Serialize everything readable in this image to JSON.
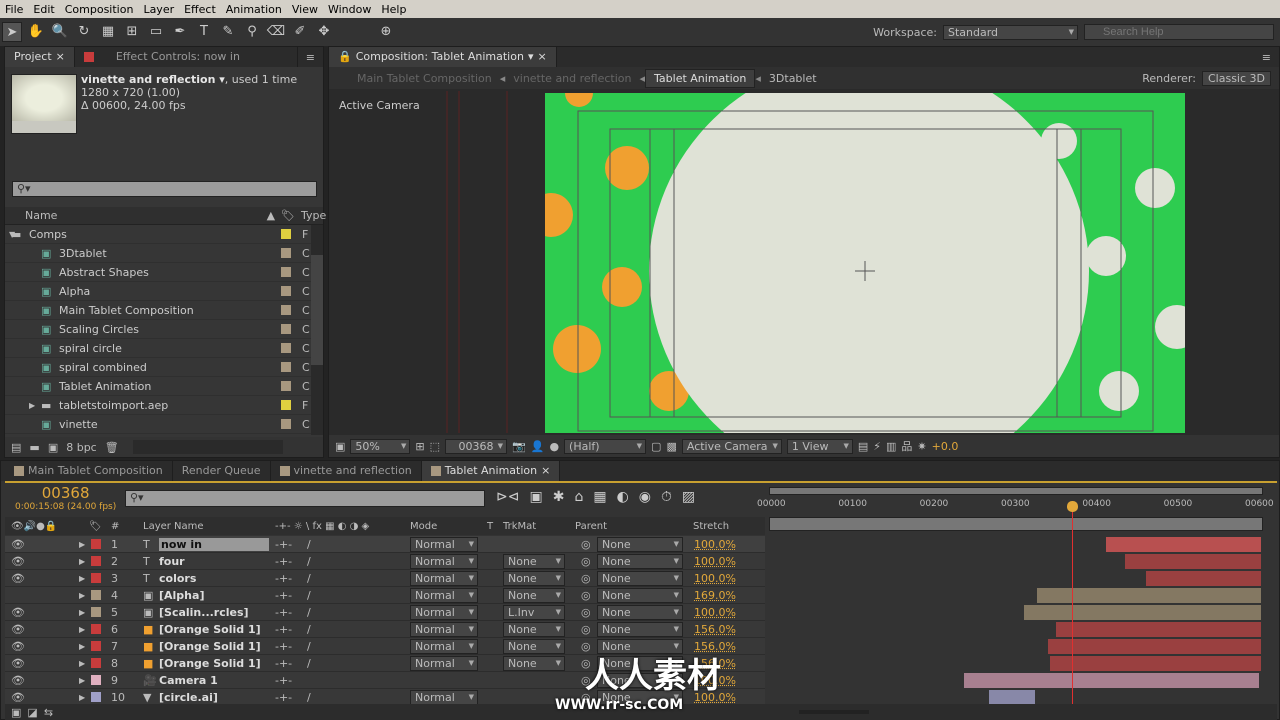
{
  "menu": [
    "File",
    "Edit",
    "Composition",
    "Layer",
    "Effect",
    "Animation",
    "View",
    "Window",
    "Help"
  ],
  "workspace": {
    "label": "Workspace:",
    "value": "Standard"
  },
  "search_help": {
    "placeholder": "Search Help"
  },
  "project": {
    "tabs": [
      "Project",
      "Effect Controls: now in"
    ],
    "selected_name": "vinette and reflection ▾",
    "used": ", used 1 time",
    "dims": "1280 x 720 (1.00)",
    "duration": "Δ 00600, 24.00 fps",
    "col_name": "Name",
    "col_type": "Type",
    "items": [
      {
        "name": "Comps",
        "kind": "folder",
        "label": "#e0d040",
        "type": "F",
        "indent": 0,
        "expanded": true
      },
      {
        "name": "3Dtablet",
        "kind": "comp",
        "label": "#a89880",
        "type": "C",
        "indent": 1
      },
      {
        "name": "Abstract Shapes",
        "kind": "comp",
        "label": "#a89880",
        "type": "C",
        "indent": 1
      },
      {
        "name": "Alpha",
        "kind": "comp",
        "label": "#a89880",
        "type": "C",
        "indent": 1
      },
      {
        "name": "Main Tablet Composition",
        "kind": "comp",
        "label": "#a89880",
        "type": "C",
        "indent": 1
      },
      {
        "name": "Scaling Circles",
        "kind": "comp",
        "label": "#a89880",
        "type": "C",
        "indent": 1
      },
      {
        "name": "spiral circle",
        "kind": "comp",
        "label": "#a89880",
        "type": "C",
        "indent": 1
      },
      {
        "name": "spiral combined",
        "kind": "comp",
        "label": "#a89880",
        "type": "C",
        "indent": 1
      },
      {
        "name": "Tablet Animation",
        "kind": "comp",
        "label": "#a89880",
        "type": "C",
        "indent": 1
      },
      {
        "name": "tabletstoimport.aep",
        "kind": "folder",
        "label": "#e0d040",
        "type": "F",
        "indent": 1,
        "expanded": false
      },
      {
        "name": "vinette",
        "kind": "comp",
        "label": "#a89880",
        "type": "C",
        "indent": 1
      }
    ],
    "bpc": "8 bpc"
  },
  "comp": {
    "tab": "Composition: Tablet Animation",
    "breadcrumbs": [
      "Main Tablet Composition",
      "vinette and reflection",
      "Tablet Animation",
      "3Dtablet"
    ],
    "active_breadcrumb": 2,
    "renderer_label": "Renderer:",
    "renderer": "Classic 3D",
    "view_label": "Active Camera",
    "zoom": "50%",
    "timecode": "00368",
    "resolution": "(Half)",
    "camera": "Active Camera",
    "views": "1 View",
    "exposure": "+0.0"
  },
  "timeline": {
    "tabs": [
      "Main Tablet Composition",
      "Render Queue",
      "vinette and reflection",
      "Tablet Animation"
    ],
    "active_tab": 3,
    "current_frame": "00368",
    "current_time": "0:00:15:08 (24.00 fps)",
    "headers": {
      "num": "#",
      "name": "Layer Name",
      "mode": "Mode",
      "t": "T",
      "trkmat": "TrkMat",
      "parent": "Parent",
      "stretch": "Stretch"
    },
    "ruler": [
      "00000",
      "00100",
      "00200",
      "00300",
      "00400",
      "00500",
      "00600"
    ],
    "duration_frames": 600,
    "cti_frame": 368,
    "layers": [
      {
        "n": "1",
        "name": "now in",
        "icon": "text",
        "label": "#c83c3c",
        "mode": "Normal",
        "trkmat": "",
        "parent": "None",
        "stretch": "100.0%",
        "in": 410,
        "out": 600,
        "bar": "#b85050",
        "eye": true
      },
      {
        "n": "2",
        "name": "four",
        "icon": "text",
        "label": "#c83c3c",
        "mode": "Normal",
        "trkmat": "None",
        "parent": "None",
        "stretch": "100.0%",
        "in": 433,
        "out": 600,
        "bar": "#9a4040",
        "eye": true
      },
      {
        "n": "3",
        "name": "colors",
        "icon": "text",
        "label": "#c83c3c",
        "mode": "Normal",
        "trkmat": "None",
        "parent": "None",
        "stretch": "100.0%",
        "in": 458,
        "out": 600,
        "bar": "#9a4040",
        "eye": true
      },
      {
        "n": "4",
        "name": "[Alpha]",
        "icon": "comp",
        "label": "#a89880",
        "mode": "Normal",
        "trkmat": "None",
        "parent": "None",
        "stretch": "169.0%",
        "in": 325,
        "out": 600,
        "bar": "#847862",
        "eye": false
      },
      {
        "n": "5",
        "name": "[Scalin...rcles]",
        "icon": "comp",
        "label": "#a89880",
        "mode": "Normal",
        "trkmat": "L.Inv",
        "parent": "None",
        "stretch": "100.0%",
        "in": 308,
        "out": 600,
        "bar": "#847862",
        "eye": true
      },
      {
        "n": "6",
        "name": "[Orange Solid 1]",
        "icon": "solid",
        "label": "#c83c3c",
        "mode": "Normal",
        "trkmat": "None",
        "parent": "None",
        "stretch": "156.0%",
        "in": 348,
        "out": 600,
        "bar": "#9a4040",
        "eye": true
      },
      {
        "n": "7",
        "name": "[Orange Solid 1]",
        "icon": "solid",
        "label": "#c83c3c",
        "mode": "Normal",
        "trkmat": "None",
        "parent": "None",
        "stretch": "156.0%",
        "in": 338,
        "out": 600,
        "bar": "#9a4040",
        "eye": true
      },
      {
        "n": "8",
        "name": "[Orange Solid 1]",
        "icon": "solid",
        "label": "#c83c3c",
        "mode": "Normal",
        "trkmat": "None",
        "parent": "None",
        "stretch": "156.0%",
        "in": 341,
        "out": 600,
        "bar": "#9a4040",
        "eye": true
      },
      {
        "n": "9",
        "name": "Camera 1",
        "icon": "camera",
        "label": "#e0b0c0",
        "mode": "",
        "trkmat": "",
        "parent": "None",
        "stretch": "100.0%",
        "in": 235,
        "out": 597,
        "bar": "#a88090",
        "eye": true
      },
      {
        "n": "10",
        "name": "[circle.ai]",
        "icon": "ai",
        "label": "#a0a0c8",
        "mode": "Normal",
        "trkmat": "",
        "parent": "None",
        "stretch": "100.0%",
        "in": 266,
        "out": 322,
        "bar": "#8888a8",
        "eye": true
      }
    ]
  },
  "watermark": {
    "text": "人人素材",
    "url": "WWW.rr-sc.COM"
  },
  "colors": {
    "accent": "#e2a83a",
    "cti": "#e03030",
    "green": "#2ecc50",
    "orange": "#f0a030",
    "cream": "#dfe2d6"
  }
}
